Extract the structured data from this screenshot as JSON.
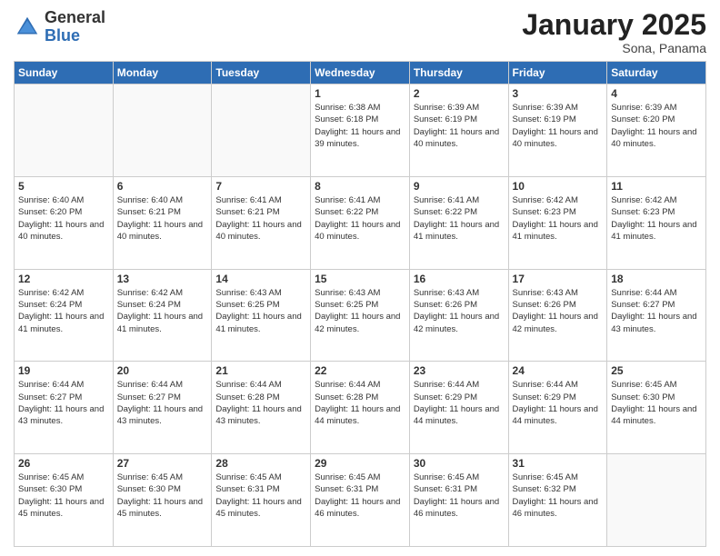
{
  "logo": {
    "general": "General",
    "blue": "Blue"
  },
  "header": {
    "month": "January 2025",
    "location": "Sona, Panama"
  },
  "days_of_week": [
    "Sunday",
    "Monday",
    "Tuesday",
    "Wednesday",
    "Thursday",
    "Friday",
    "Saturday"
  ],
  "weeks": [
    [
      {
        "day": "",
        "info": ""
      },
      {
        "day": "",
        "info": ""
      },
      {
        "day": "",
        "info": ""
      },
      {
        "day": "1",
        "info": "Sunrise: 6:38 AM\nSunset: 6:18 PM\nDaylight: 11 hours and 39 minutes."
      },
      {
        "day": "2",
        "info": "Sunrise: 6:39 AM\nSunset: 6:19 PM\nDaylight: 11 hours and 40 minutes."
      },
      {
        "day": "3",
        "info": "Sunrise: 6:39 AM\nSunset: 6:19 PM\nDaylight: 11 hours and 40 minutes."
      },
      {
        "day": "4",
        "info": "Sunrise: 6:39 AM\nSunset: 6:20 PM\nDaylight: 11 hours and 40 minutes."
      }
    ],
    [
      {
        "day": "5",
        "info": "Sunrise: 6:40 AM\nSunset: 6:20 PM\nDaylight: 11 hours and 40 minutes."
      },
      {
        "day": "6",
        "info": "Sunrise: 6:40 AM\nSunset: 6:21 PM\nDaylight: 11 hours and 40 minutes."
      },
      {
        "day": "7",
        "info": "Sunrise: 6:41 AM\nSunset: 6:21 PM\nDaylight: 11 hours and 40 minutes."
      },
      {
        "day": "8",
        "info": "Sunrise: 6:41 AM\nSunset: 6:22 PM\nDaylight: 11 hours and 40 minutes."
      },
      {
        "day": "9",
        "info": "Sunrise: 6:41 AM\nSunset: 6:22 PM\nDaylight: 11 hours and 41 minutes."
      },
      {
        "day": "10",
        "info": "Sunrise: 6:42 AM\nSunset: 6:23 PM\nDaylight: 11 hours and 41 minutes."
      },
      {
        "day": "11",
        "info": "Sunrise: 6:42 AM\nSunset: 6:23 PM\nDaylight: 11 hours and 41 minutes."
      }
    ],
    [
      {
        "day": "12",
        "info": "Sunrise: 6:42 AM\nSunset: 6:24 PM\nDaylight: 11 hours and 41 minutes."
      },
      {
        "day": "13",
        "info": "Sunrise: 6:42 AM\nSunset: 6:24 PM\nDaylight: 11 hours and 41 minutes."
      },
      {
        "day": "14",
        "info": "Sunrise: 6:43 AM\nSunset: 6:25 PM\nDaylight: 11 hours and 41 minutes."
      },
      {
        "day": "15",
        "info": "Sunrise: 6:43 AM\nSunset: 6:25 PM\nDaylight: 11 hours and 42 minutes."
      },
      {
        "day": "16",
        "info": "Sunrise: 6:43 AM\nSunset: 6:26 PM\nDaylight: 11 hours and 42 minutes."
      },
      {
        "day": "17",
        "info": "Sunrise: 6:43 AM\nSunset: 6:26 PM\nDaylight: 11 hours and 42 minutes."
      },
      {
        "day": "18",
        "info": "Sunrise: 6:44 AM\nSunset: 6:27 PM\nDaylight: 11 hours and 43 minutes."
      }
    ],
    [
      {
        "day": "19",
        "info": "Sunrise: 6:44 AM\nSunset: 6:27 PM\nDaylight: 11 hours and 43 minutes."
      },
      {
        "day": "20",
        "info": "Sunrise: 6:44 AM\nSunset: 6:27 PM\nDaylight: 11 hours and 43 minutes."
      },
      {
        "day": "21",
        "info": "Sunrise: 6:44 AM\nSunset: 6:28 PM\nDaylight: 11 hours and 43 minutes."
      },
      {
        "day": "22",
        "info": "Sunrise: 6:44 AM\nSunset: 6:28 PM\nDaylight: 11 hours and 44 minutes."
      },
      {
        "day": "23",
        "info": "Sunrise: 6:44 AM\nSunset: 6:29 PM\nDaylight: 11 hours and 44 minutes."
      },
      {
        "day": "24",
        "info": "Sunrise: 6:44 AM\nSunset: 6:29 PM\nDaylight: 11 hours and 44 minutes."
      },
      {
        "day": "25",
        "info": "Sunrise: 6:45 AM\nSunset: 6:30 PM\nDaylight: 11 hours and 44 minutes."
      }
    ],
    [
      {
        "day": "26",
        "info": "Sunrise: 6:45 AM\nSunset: 6:30 PM\nDaylight: 11 hours and 45 minutes."
      },
      {
        "day": "27",
        "info": "Sunrise: 6:45 AM\nSunset: 6:30 PM\nDaylight: 11 hours and 45 minutes."
      },
      {
        "day": "28",
        "info": "Sunrise: 6:45 AM\nSunset: 6:31 PM\nDaylight: 11 hours and 45 minutes."
      },
      {
        "day": "29",
        "info": "Sunrise: 6:45 AM\nSunset: 6:31 PM\nDaylight: 11 hours and 46 minutes."
      },
      {
        "day": "30",
        "info": "Sunrise: 6:45 AM\nSunset: 6:31 PM\nDaylight: 11 hours and 46 minutes."
      },
      {
        "day": "31",
        "info": "Sunrise: 6:45 AM\nSunset: 6:32 PM\nDaylight: 11 hours and 46 minutes."
      },
      {
        "day": "",
        "info": ""
      }
    ]
  ]
}
